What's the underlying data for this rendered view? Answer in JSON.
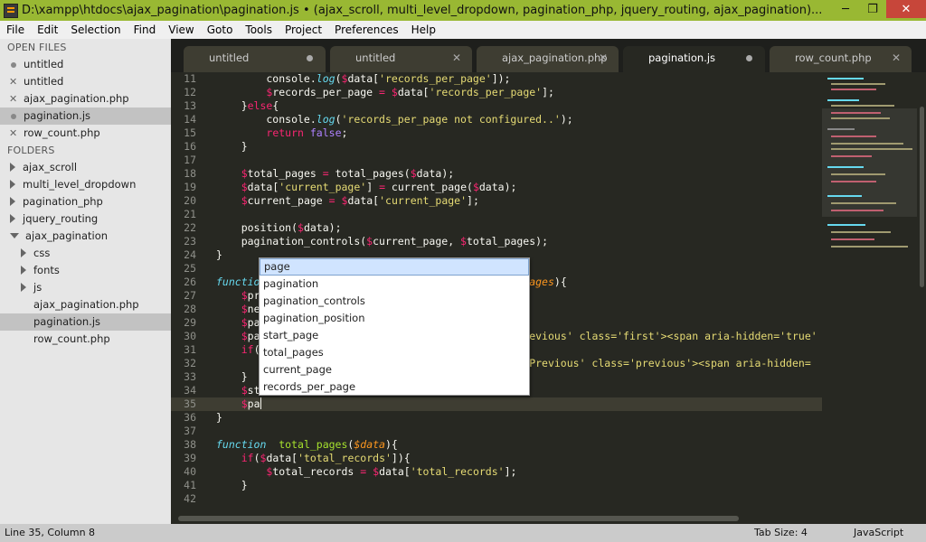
{
  "window": {
    "title": "D:\\xampp\\htdocs\\ajax_pagination\\pagination.js • (ajax_scroll, multi_level_dropdown, pagination_php, jquery_routing, ajax_pagination)...",
    "minimize": "─",
    "restore": "❐",
    "close": "✕"
  },
  "menu": [
    "File",
    "Edit",
    "Selection",
    "Find",
    "View",
    "Goto",
    "Tools",
    "Project",
    "Preferences",
    "Help"
  ],
  "sidebar": {
    "open_files_header": "OPEN FILES",
    "open_files": [
      {
        "name": "untitled",
        "marker": "dot"
      },
      {
        "name": "untitled",
        "marker": "x"
      },
      {
        "name": "ajax_pagination.php",
        "marker": "x"
      },
      {
        "name": "pagination.js",
        "marker": "dot",
        "selected": true
      },
      {
        "name": "row_count.php",
        "marker": "x"
      }
    ],
    "folders_header": "FOLDERS",
    "folders": [
      {
        "name": "ajax_scroll",
        "depth": 0,
        "kind": "folder-closed"
      },
      {
        "name": "multi_level_dropdown",
        "depth": 0,
        "kind": "folder-closed"
      },
      {
        "name": "pagination_php",
        "depth": 0,
        "kind": "folder-closed"
      },
      {
        "name": "jquery_routing",
        "depth": 0,
        "kind": "folder-closed"
      },
      {
        "name": "ajax_pagination",
        "depth": 0,
        "kind": "folder-open"
      },
      {
        "name": "css",
        "depth": 1,
        "kind": "folder-closed"
      },
      {
        "name": "fonts",
        "depth": 1,
        "kind": "folder-closed"
      },
      {
        "name": "js",
        "depth": 1,
        "kind": "folder-closed"
      },
      {
        "name": "ajax_pagination.php",
        "depth": 1,
        "kind": "file"
      },
      {
        "name": "pagination.js",
        "depth": 1,
        "kind": "file",
        "selected": true
      },
      {
        "name": "row_count.php",
        "depth": 1,
        "kind": "file"
      }
    ]
  },
  "tabs": [
    {
      "label": "untitled",
      "marker": "dot"
    },
    {
      "label": "untitled",
      "marker": "x"
    },
    {
      "label": "ajax_pagination.php",
      "marker": "x"
    },
    {
      "label": "pagination.js",
      "marker": "dot",
      "active": true
    },
    {
      "label": "row_count.php",
      "marker": "x"
    }
  ],
  "line_numbers": [
    "11",
    "12",
    "13",
    "14",
    "15",
    "16",
    "17",
    "18",
    "19",
    "20",
    "21",
    "22",
    "23",
    "24",
    "25",
    "26",
    "27",
    "28",
    "29",
    "30",
    "31",
    "32",
    "33",
    "34",
    "35",
    "36",
    "37",
    "38",
    "39",
    "40",
    "41",
    "42"
  ],
  "autocomplete": [
    "page",
    "pagination",
    "pagination_controls",
    "pagination_position",
    "start_page",
    "total_pages",
    "current_page",
    "records_per_page"
  ],
  "status": {
    "position": "Line 35, Column 8",
    "tab_size": "Tab Size: 4",
    "syntax": "JavaScript"
  },
  "colors": {
    "titlebar": "#99b833",
    "editor_bg": "#272822",
    "keyword": "#f92672",
    "string": "#e6db74",
    "function_kw": "#66d9ef",
    "function_name": "#a6e22e",
    "param": "#fd971f"
  }
}
